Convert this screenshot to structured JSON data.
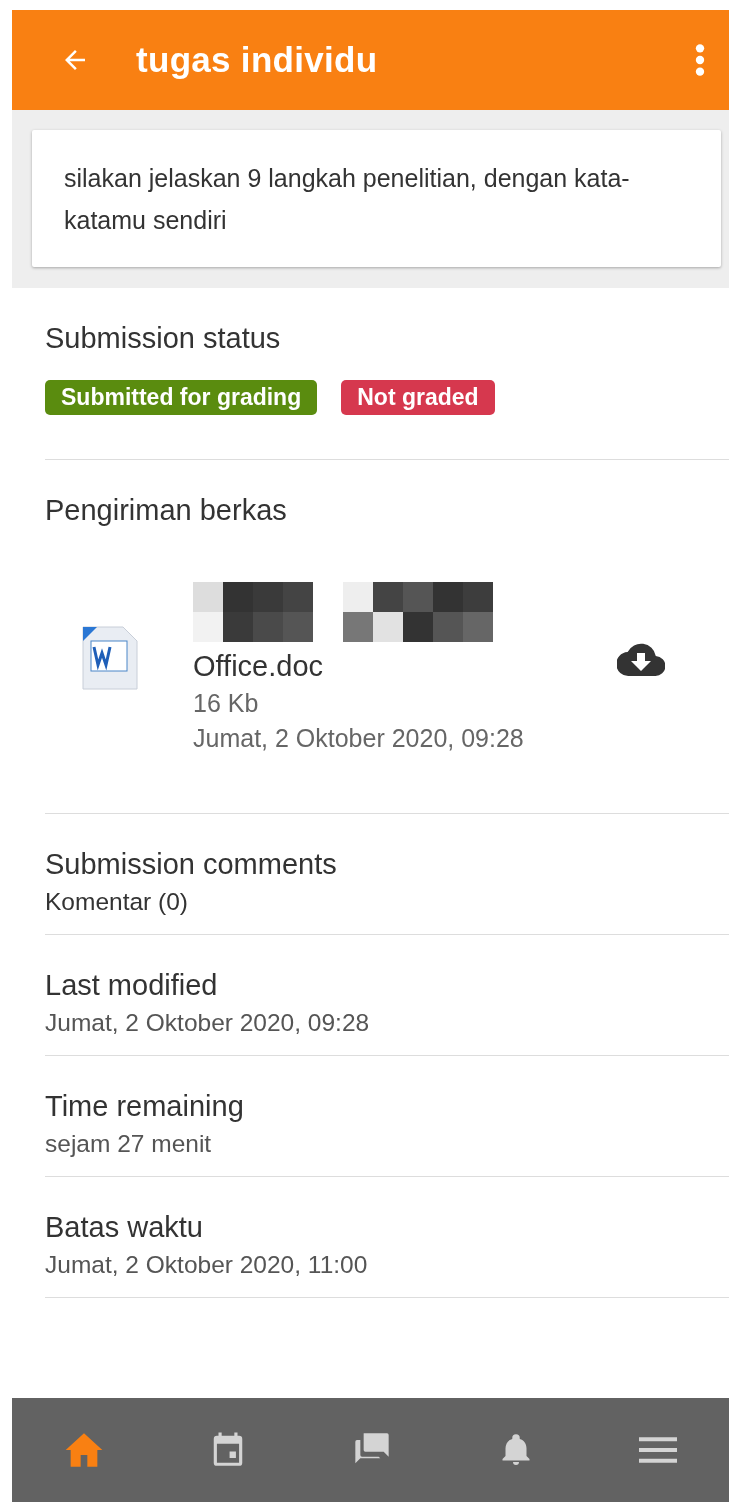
{
  "header": {
    "title": "tugas individu"
  },
  "description": "silakan jelaskan  9 langkah penelitian, dengan kata-katamu sendiri",
  "submission_status": {
    "title": "Submission status",
    "badges": [
      {
        "label": "Submitted for grading",
        "color": "#5a8c0f"
      },
      {
        "label": "Not graded",
        "color": "#d6384e"
      }
    ]
  },
  "file_submissions": {
    "title": "Pengiriman berkas",
    "file": {
      "name": "Office.doc",
      "size": "16 Kb",
      "date": "Jumat, 2 Oktober 2020, 09:28"
    }
  },
  "info_sections": [
    {
      "title": "Submission comments",
      "value": "Komentar (0)",
      "kind": "link"
    },
    {
      "title": "Last modified",
      "value": "Jumat, 2 Oktober 2020, 09:28",
      "kind": "plain"
    },
    {
      "title": "Time remaining",
      "value": "sejam 27 menit",
      "kind": "plain"
    },
    {
      "title": "Batas waktu",
      "value": "Jumat, 2 Oktober 2020, 11:00",
      "kind": "plain"
    }
  ],
  "bottom_nav": [
    {
      "kind": "home",
      "selected": true
    },
    {
      "kind": "calendar",
      "selected": false
    },
    {
      "kind": "messages",
      "selected": false
    },
    {
      "kind": "notifications",
      "selected": false
    },
    {
      "kind": "menu",
      "selected": false
    }
  ]
}
